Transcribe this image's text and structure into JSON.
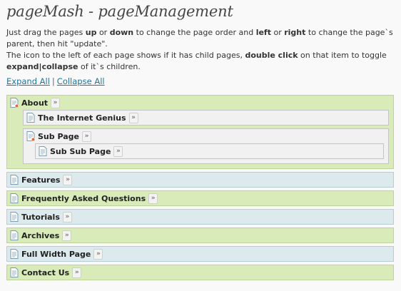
{
  "page": {
    "title": "pageMash - pageManagement"
  },
  "instructions": {
    "t1": "Just drag the pages ",
    "b1": "up",
    "t2": " or ",
    "b2": "down",
    "t3": " to change the page order and ",
    "b3": "left",
    "t4": " or ",
    "b4": "right",
    "t5": " to change the page`s parent, then hit \"update\".",
    "t6": "The icon to the left of each page shows if it has child pages, ",
    "b5": "double click",
    "t7": " on that item to toggle ",
    "b6": "expand|collapse",
    "t8": " of it`s children."
  },
  "links": {
    "expand_all": "Expand All",
    "separator": "|",
    "collapse_all": "Collapse All"
  },
  "arrow_glyph": "»",
  "pages": [
    {
      "label": "About",
      "has_children": true,
      "children": [
        {
          "label": "The Internet Genius"
        },
        {
          "label": "Sub Page",
          "children": [
            {
              "label": "Sub Sub Page"
            }
          ]
        }
      ]
    },
    {
      "label": "Features"
    },
    {
      "label": "Frequently Asked Questions"
    },
    {
      "label": "Tutorials"
    },
    {
      "label": "Archives"
    },
    {
      "label": "Full Width Page"
    },
    {
      "label": "Contact Us"
    }
  ],
  "colors": {
    "row_green": "#d8ebb8",
    "row_blue": "#dce9ed",
    "child_row": "#f1f1f1",
    "link": "#21759b"
  },
  "icons": {
    "page": "page-icon",
    "page_with_children": "page-with-children-icon",
    "arrow": "double-chevron-right-icon"
  }
}
